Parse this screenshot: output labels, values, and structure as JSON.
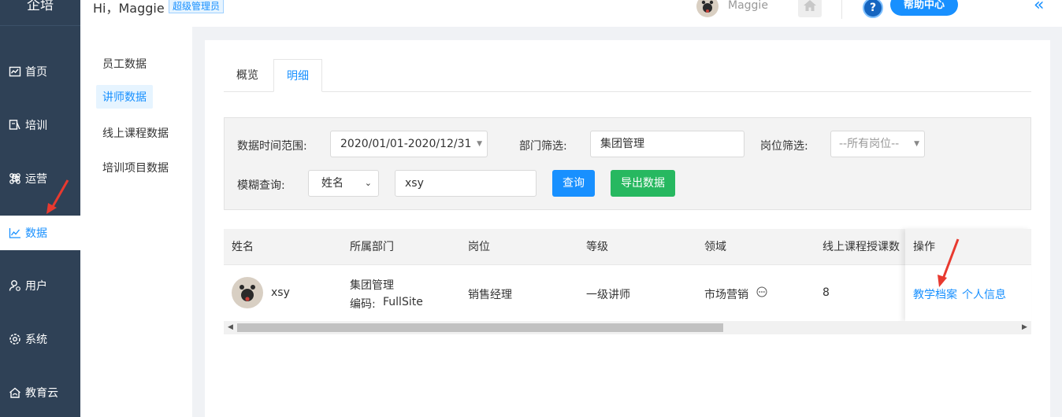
{
  "app": {
    "logo": "企培"
  },
  "header": {
    "greeting": "Hi，Maggie",
    "role_badge": "超级管理员",
    "username": "Maggie",
    "help_label": "帮助中心",
    "help_icon": "?"
  },
  "leftnav": {
    "items": [
      {
        "label": "首页",
        "icon": "dashboard-icon"
      },
      {
        "label": "培训",
        "icon": "training-icon"
      },
      {
        "label": "运营",
        "icon": "operation-icon"
      },
      {
        "label": "数据",
        "icon": "chart-icon",
        "active": true
      },
      {
        "label": "用户",
        "icon": "user-icon"
      },
      {
        "label": "系统",
        "icon": "gear-icon"
      },
      {
        "label": "教育云",
        "icon": "cloud-icon"
      }
    ]
  },
  "subnav": {
    "items": [
      {
        "label": "员工数据"
      },
      {
        "label": "讲师数据",
        "active": true
      },
      {
        "label": "线上课程数据"
      },
      {
        "label": "培训项目数据"
      }
    ]
  },
  "tabs": [
    {
      "label": "概览"
    },
    {
      "label": "明细",
      "active": true
    }
  ],
  "filter": {
    "date_label": "数据时间范围:",
    "date_value": "2020/01/01-2020/12/31",
    "dept_label": "部门筛选:",
    "dept_value": "集团管理",
    "post_label": "岗位筛选:",
    "post_placeholder": "--所有岗位--",
    "fuzzy_label": "模糊查询:",
    "fuzzy_field": "姓名",
    "fuzzy_value": "xsy",
    "query_btn": "查询",
    "export_btn": "导出数据"
  },
  "table": {
    "columns": [
      "姓名",
      "所属部门",
      "岗位",
      "等级",
      "领域",
      "线上课程授课数",
      "操作"
    ],
    "rows": [
      {
        "name": "xsy",
        "dept": "集团管理",
        "code_label": "编码:",
        "code": "FullSite",
        "post": "销售经理",
        "level": "一级讲师",
        "field": "市场营销",
        "courses": "8",
        "actions": [
          "教学档案",
          "个人信息"
        ]
      }
    ]
  },
  "colors": {
    "nav_bg": "#2f4156",
    "accent": "#1890ff",
    "export_green": "#27b860",
    "annotation_red": "#e8392f"
  }
}
